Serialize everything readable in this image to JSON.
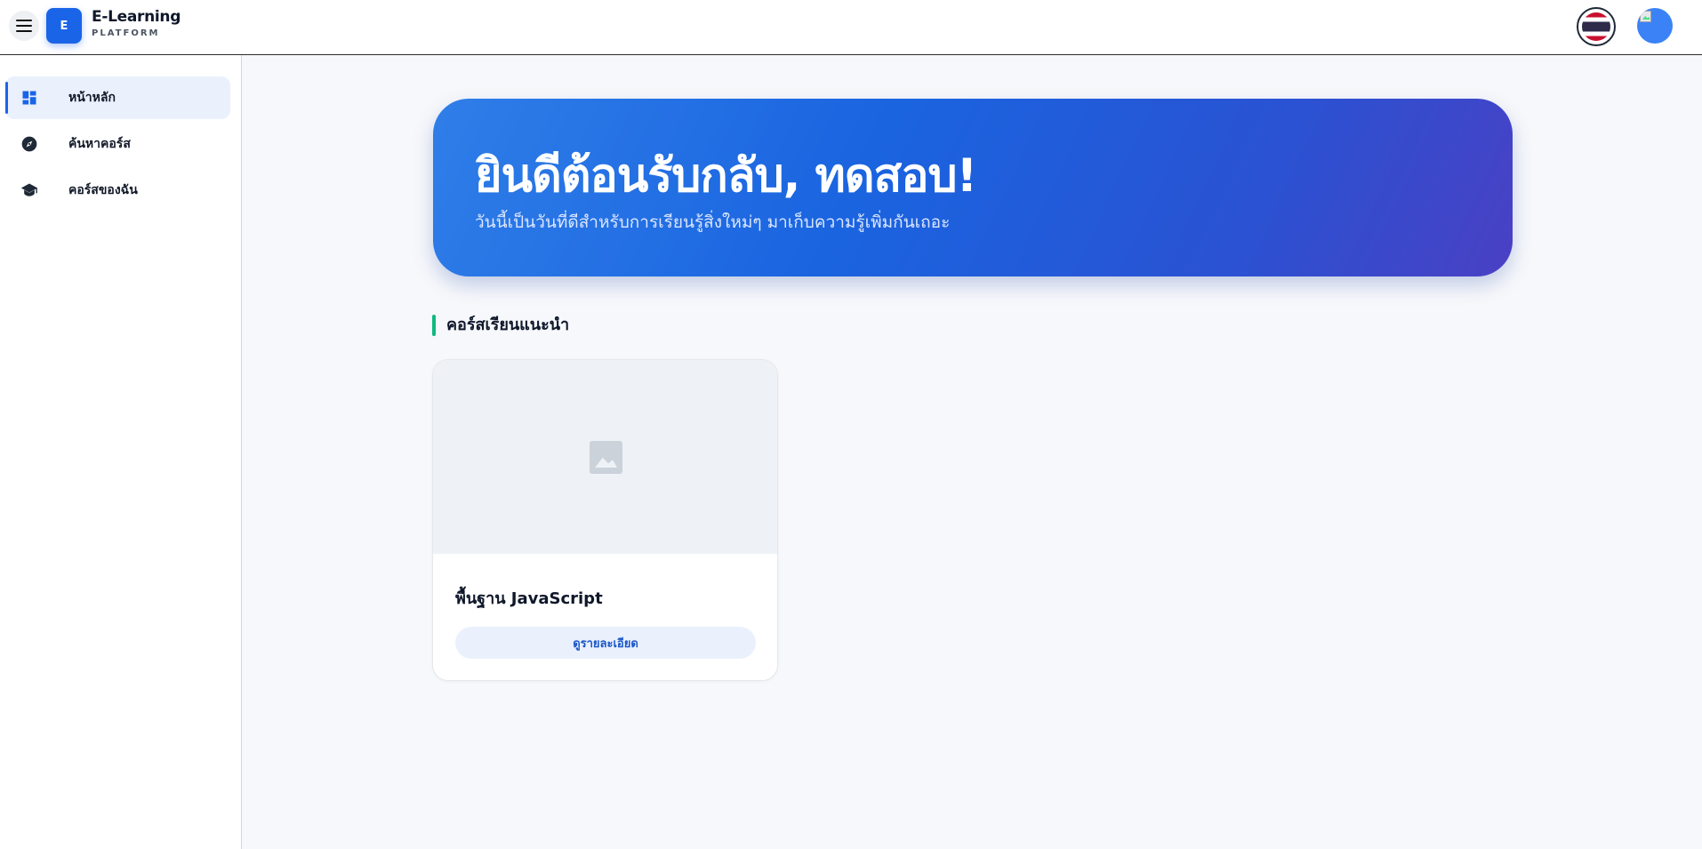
{
  "header": {
    "logo_letter": "E",
    "brand_name": "E-Learning",
    "brand_sub": "PLATFORM",
    "menu_icon": "hamburger-menu-icon",
    "language_icon": "thailand-flag-icon",
    "accent_color": "#1a64e8"
  },
  "sidebar": {
    "items": [
      {
        "label": "หน้าหลัก",
        "icon": "dashboard-icon",
        "active": true
      },
      {
        "label": "ค้นหาคอร์ส",
        "icon": "compass-icon",
        "active": false
      },
      {
        "label": "คอร์สของฉัน",
        "icon": "graduation-cap-icon",
        "active": false
      }
    ]
  },
  "hero": {
    "title": "ยินดีต้อนรับกลับ, ทดสอบ!",
    "subtitle": "วันนี้เป็นวันที่ดีสำหรับการเรียนรู้สิ่งใหม่ๆ มาเก็บความรู้เพิ่มกันเถอะ"
  },
  "recommended": {
    "title": "คอร์สเรียนแนะนำ",
    "accent_color": "#10b981",
    "courses": [
      {
        "title": "พื้นฐาน JavaScript",
        "button_label": "ดูรายละเอียด",
        "thumbnail_icon": "image-placeholder-icon"
      }
    ]
  }
}
